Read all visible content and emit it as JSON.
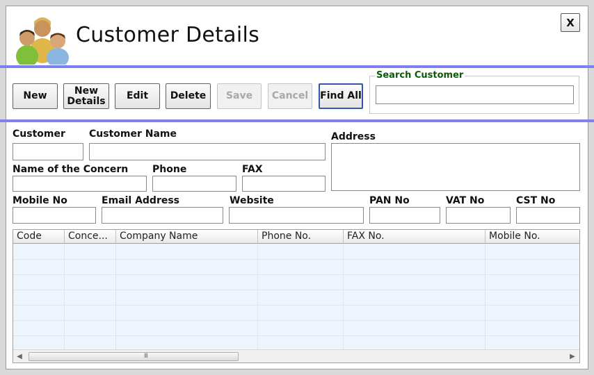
{
  "window": {
    "title": "Customer Details",
    "close_label": "X"
  },
  "toolbar": {
    "new_label": "New",
    "new_details_label_1": "New",
    "new_details_label_2": "Details",
    "edit_label": "Edit",
    "delete_label": "Delete",
    "save_label": "Save",
    "cancel_label": "Cancel",
    "find_all_label": "Find All"
  },
  "search": {
    "label": "Search Customer",
    "value": ""
  },
  "form": {
    "customer_label": "Customer",
    "customer_name_label": "Customer Name",
    "address_label": "Address",
    "concern_label": "Name of the Concern",
    "phone_label": "Phone",
    "fax_label": "FAX",
    "mobile_label": "Mobile No",
    "email_label": "Email Address",
    "website_label": "Website",
    "pan_label": "PAN No",
    "vat_label": "VAT No",
    "cst_label": "CST No"
  },
  "grid": {
    "columns": [
      "Code",
      "Conce...",
      "Company Name",
      "Phone No.",
      "FAX No.",
      "Mobile No."
    ],
    "scroll_grip": "III"
  },
  "colors": {
    "separator": "#8080f0",
    "search_label": "#0a5a0a",
    "grid_bg": "#eef4fb"
  },
  "icons": {
    "header": "users-group-icon"
  }
}
